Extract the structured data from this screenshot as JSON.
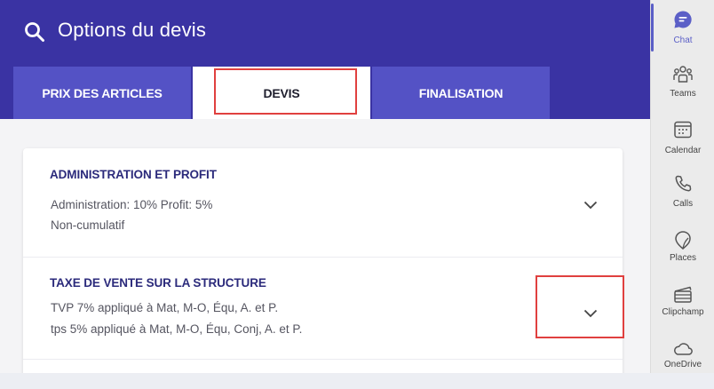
{
  "header": {
    "title": "Options du devis",
    "tabs": [
      {
        "label": "PRIX DES ARTICLES",
        "active": false
      },
      {
        "label": "DEVIS",
        "active": true
      },
      {
        "label": "FINALISATION",
        "active": false
      }
    ]
  },
  "sections": [
    {
      "title": "ADMINISTRATION ET PROFIT",
      "lines": [
        "Administration:  10%  Profit:  5%",
        "Non-cumulatif"
      ]
    },
    {
      "title": "TAXE DE VENTE SUR LA STRUCTURE",
      "lines": [
        "TVP 7% appliqué à Mat, M-O, Équ, A. et P.",
        "tps   5% appliqué à Mat, M-O, Équ, Conj, A. et P."
      ]
    }
  ],
  "rail": {
    "items": [
      {
        "label": "Chat",
        "icon": "chat-icon",
        "active": true
      },
      {
        "label": "Teams",
        "icon": "teams-icon"
      },
      {
        "label": "Calendar",
        "icon": "calendar-icon"
      },
      {
        "label": "Calls",
        "icon": "phone-icon"
      },
      {
        "label": "Places",
        "icon": "places-icon"
      },
      {
        "label": "Clipchamp",
        "icon": "clipchamp-icon"
      },
      {
        "label": "OneDrive",
        "icon": "onedrive-icon"
      }
    ]
  },
  "colors": {
    "header": "#3a33a3",
    "tab_inactive": "#5452c5",
    "highlight": "#e0403f",
    "section_title": "#2b2a7b",
    "rail_accent": "#5b5fc7"
  }
}
